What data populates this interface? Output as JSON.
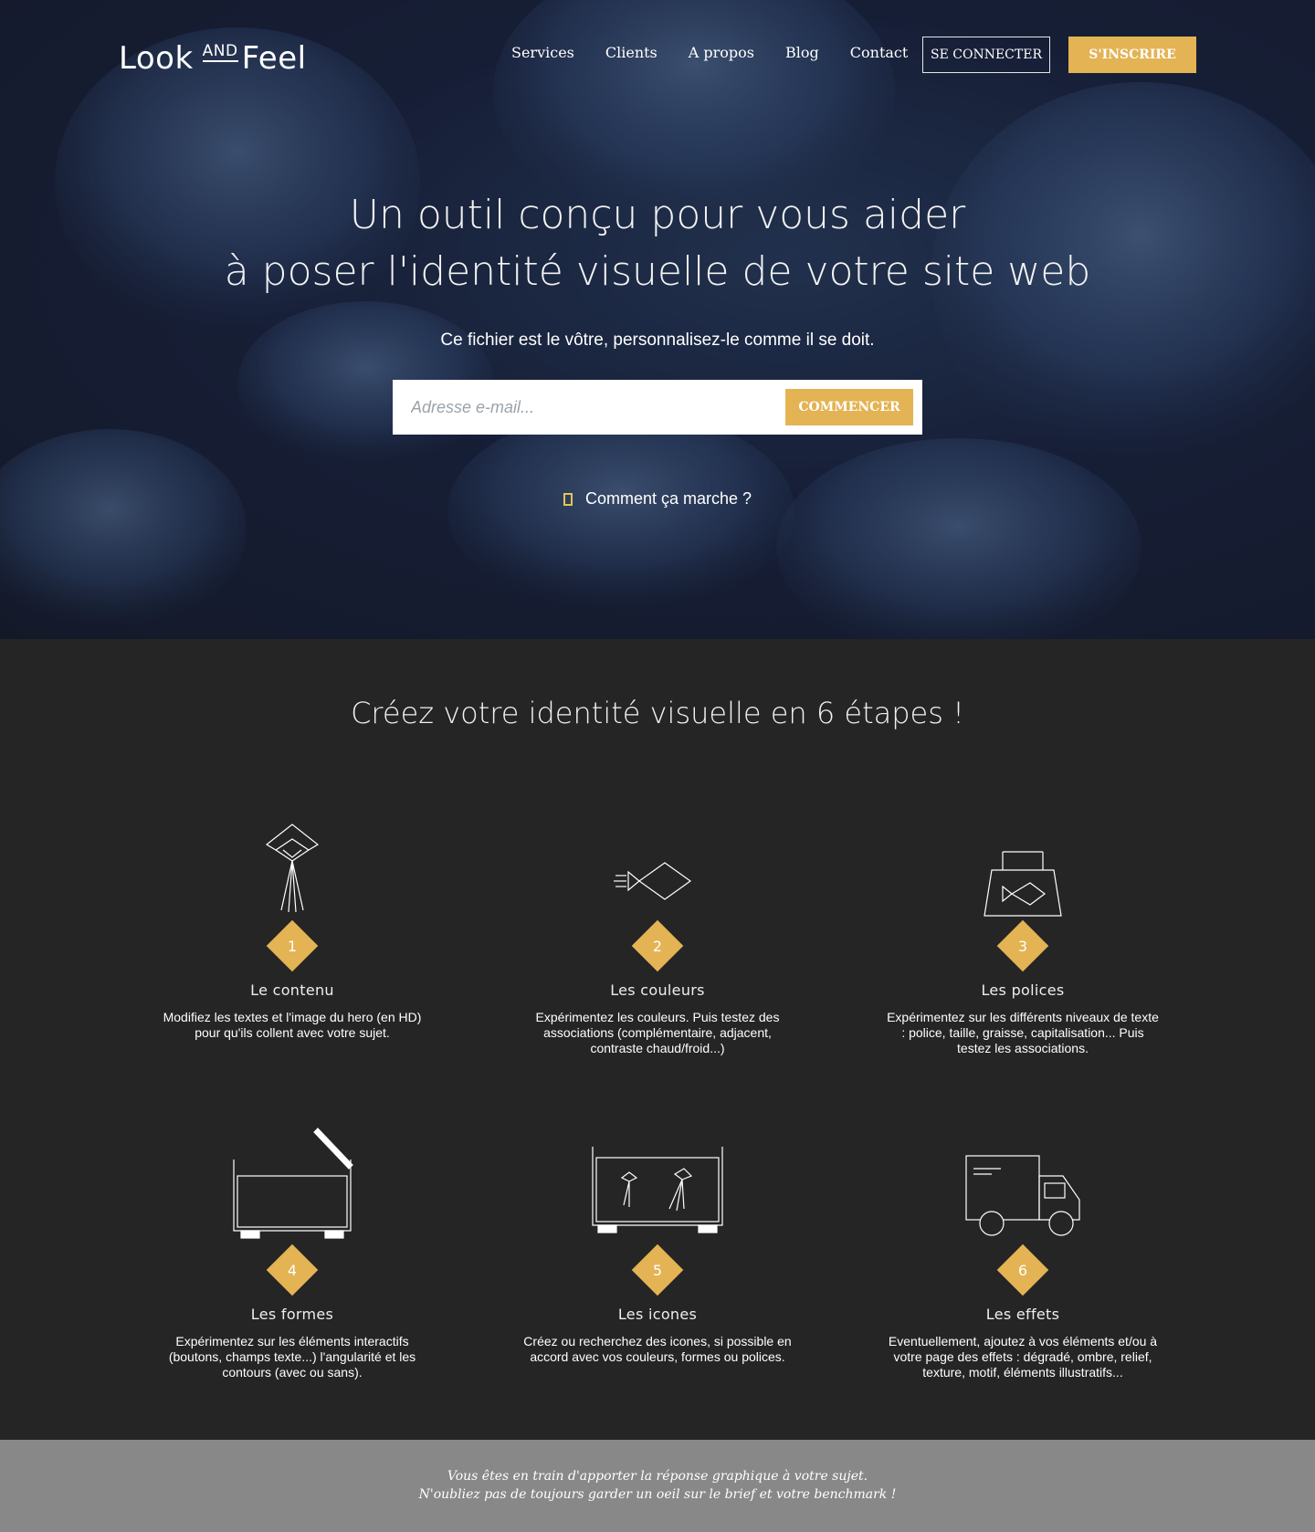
{
  "header": {
    "logo": {
      "look": "Look",
      "and": "AND",
      "feel": "Feel"
    },
    "nav": [
      "Services",
      "Clients",
      "A propos",
      "Blog",
      "Contact"
    ],
    "login_label": "SE CONNECTER",
    "signup_label": "S'INSCRIRE"
  },
  "hero": {
    "title_line1": "Un outil conçu pour vous aider",
    "title_line2": "à poser l'identité visuelle de votre site web",
    "subtitle": "Ce fichier est le vôtre, personnalisez-le comme il se doit.",
    "email_placeholder": "Adresse e-mail...",
    "start_label": "COMMENCER",
    "how_label": "Comment ça marche ?"
  },
  "steps": {
    "title": "Créez votre identité visuelle en 6 étapes !",
    "items": [
      {
        "num": "1",
        "title": "Le contenu",
        "desc": "Modifiez les textes et l'image du hero (en HD) pour qu'ils collent avec votre sujet.",
        "icon": "jellyfish-icon"
      },
      {
        "num": "2",
        "title": "Les couleurs",
        "desc": "Expérimentez les couleurs. Puis testez des associations (complémentaire, adjacent, contraste chaud/froid...)",
        "icon": "fish-icon"
      },
      {
        "num": "3",
        "title": "Les polices",
        "desc": "Expérimentez sur les différents niveaux de texte : police, taille, graisse, capitalisation... Puis testez les associations.",
        "icon": "fish-bag-icon"
      },
      {
        "num": "4",
        "title": "Les formes",
        "desc": "Expérimentez sur les éléments interactifs (boutons, champs texte...) l'angularité et les contours (avec ou sans).",
        "icon": "aquarium-open-icon"
      },
      {
        "num": "5",
        "title": "Les icones",
        "desc": "Créez ou recherchez des icones, si possible en accord avec vos couleurs, formes ou polices.",
        "icon": "aquarium-jellyfish-icon"
      },
      {
        "num": "6",
        "title": "Les effets",
        "desc": "Eventuellement, ajoutez à vos éléments et/ou à votre page des effets : dégradé, ombre, relief, texture, motif, éléments illustratifs...",
        "icon": "truck-icon"
      }
    ]
  },
  "footer": {
    "line1": "Vous êtes en train d'apporter la réponse graphique à votre sujet.",
    "line2": "N'oubliez pas de toujours garder un oeil sur le brief et votre benchmark !"
  },
  "colors": {
    "accent": "#e3b354",
    "dark_bg": "#252525",
    "footer_bg": "#888888",
    "hero_blue": "#2a3f63"
  }
}
